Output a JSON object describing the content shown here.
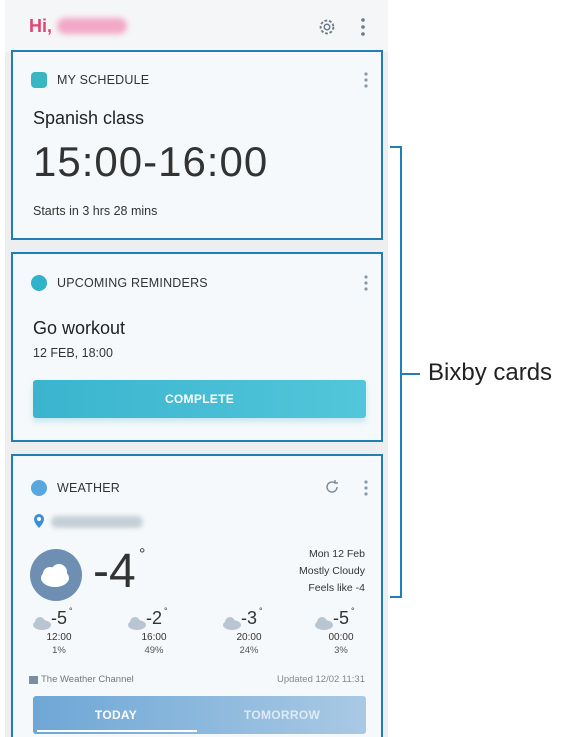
{
  "topbar": {
    "greeting": "Hi,"
  },
  "schedule_card": {
    "header": "MY SCHEDULE",
    "event": "Spanish class",
    "time": "15:00-16:00",
    "note": "Starts in 3 hrs 28 mins"
  },
  "reminder_card": {
    "header": "UPCOMING REMINDERS",
    "title": "Go workout",
    "datetime": "12 FEB, 18:00",
    "button": "COMPLETE"
  },
  "weather_card": {
    "header": "WEATHER",
    "temp": "-4",
    "deg": "°",
    "date": "Mon 12 Feb",
    "condition": "Mostly Cloudy",
    "feels": "Feels like -4",
    "hourly": [
      {
        "temp": "-5",
        "time": "12:00",
        "precip": "1%"
      },
      {
        "temp": "-2",
        "time": "16:00",
        "precip": "49%"
      },
      {
        "temp": "-3",
        "time": "20:00",
        "precip": "24%"
      },
      {
        "temp": "-5",
        "time": "00:00",
        "precip": "3%"
      }
    ],
    "source": "The Weather Channel",
    "updated": "Updated 12/02 11:31",
    "tabs": [
      "TODAY",
      "TOMORROW"
    ]
  },
  "annotation": {
    "label": "Bixby cards"
  },
  "colors": {
    "accent_border": "#1f7fb6",
    "greeting": "#e2456f",
    "complete": "#3ab4cf",
    "tabs": "#6ea7d6"
  }
}
